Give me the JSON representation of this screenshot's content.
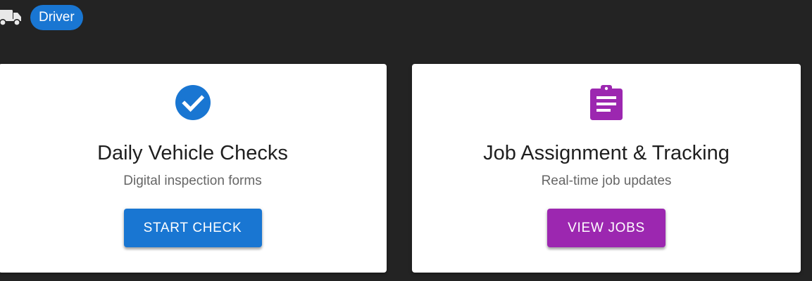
{
  "header": {
    "truck_icon": "truck-icon",
    "role_label": "Driver"
  },
  "colors": {
    "background": "#232323",
    "primary": "#1976d2",
    "secondary": "#9c27b0",
    "card": "#ffffff"
  },
  "cards": [
    {
      "icon": "check-circle-icon",
      "title": "Daily Vehicle Checks",
      "subtitle": "Digital inspection forms",
      "button_label": "START CHECK"
    },
    {
      "icon": "clipboard-icon",
      "title": "Job Assignment & Tracking",
      "subtitle": "Real-time job updates",
      "button_label": "VIEW JOBS"
    }
  ]
}
